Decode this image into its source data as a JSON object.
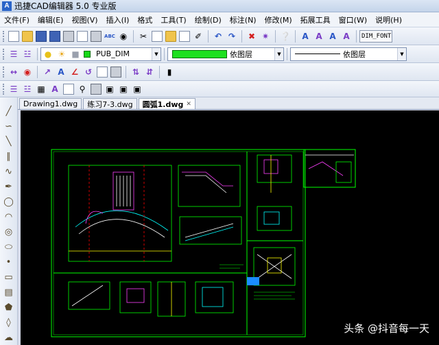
{
  "app": {
    "logo": "A",
    "title": "迅捷CAD编辑器 5.0 专业版"
  },
  "menu": [
    "文件(F)",
    "编辑(E)",
    "视图(V)",
    "插入(I)",
    "格式",
    "工具(T)",
    "绘制(D)",
    "标注(N)",
    "修改(M)",
    "拓展工具",
    "窗口(W)",
    "说明(H)"
  ],
  "toolbar": {
    "dim_font": "DIM_FONT",
    "spell_glyph": "ABC",
    "text_style_glyphs": [
      "A",
      "A",
      "A",
      "A"
    ]
  },
  "layer": {
    "name": "PUB_DIM",
    "swatch_color": "#17d817"
  },
  "color": {
    "label": "依图层",
    "swatch_color": "#1ee01e"
  },
  "linetype": {
    "label": "依图层"
  },
  "tabs": [
    {
      "label": "Drawing1.dwg",
      "active": false
    },
    {
      "label": "练习7-3.dwg",
      "active": false
    },
    {
      "label": "圆弧1.dwg",
      "active": true
    }
  ],
  "canvas": {
    "background": "#000000",
    "line_color": "#00ff00"
  },
  "watermark": "头条 @抖音每一天"
}
